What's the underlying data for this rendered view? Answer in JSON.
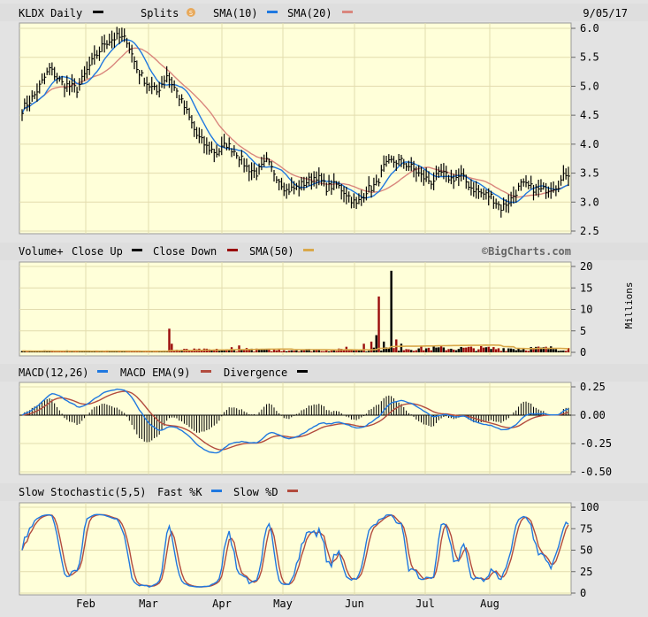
{
  "chart_data": {
    "type": "line",
    "ticker_label": "KLDX Daily",
    "date": "9/05/17",
    "watermark": "©BigCharts.com",
    "x_months": [
      "Feb",
      "Mar",
      "Apr",
      "May",
      "Jun",
      "Jul",
      "Aug"
    ],
    "colors": {
      "panel_bg": "#ffffd9",
      "grid": "#e2dcae",
      "header_bg": "#dedede",
      "sma10": "#1f78e0",
      "sma20": "#d9867d",
      "volume_up": "#000000",
      "volume_down": "#9a0b0b",
      "volume_sma": "#d9a84a",
      "macd": "#1f78e0",
      "macd_ema": "#b24b3e",
      "fast_k": "#1f78e0",
      "slow_d": "#b24b3e"
    },
    "price_panel": {
      "legend": {
        "name": "KLDX Daily",
        "splits": "Splits",
        "sma10": "SMA(10)",
        "sma20": "SMA(20)"
      },
      "ylim": [
        2.5,
        6.0
      ],
      "y_ticks": [
        "6.0",
        "5.5",
        "5.0",
        "4.5",
        "4.0",
        "3.5",
        "3.0",
        "2.5"
      ],
      "close_anchors": [
        [
          0,
          4.6
        ],
        [
          5,
          4.85
        ],
        [
          11,
          5.3
        ],
        [
          16,
          5.05
        ],
        [
          22,
          4.95
        ],
        [
          27,
          5.35
        ],
        [
          33,
          5.75
        ],
        [
          38,
          5.85
        ],
        [
          42,
          5.8
        ],
        [
          46,
          5.3
        ],
        [
          50,
          5.05
        ],
        [
          54,
          4.9
        ],
        [
          58,
          5.2
        ],
        [
          62,
          4.9
        ],
        [
          66,
          4.55
        ],
        [
          70,
          4.15
        ],
        [
          74,
          3.95
        ],
        [
          78,
          3.85
        ],
        [
          82,
          4.0
        ],
        [
          86,
          3.85
        ],
        [
          90,
          3.6
        ],
        [
          94,
          3.5
        ],
        [
          98,
          3.7
        ],
        [
          102,
          3.45
        ],
        [
          106,
          3.2
        ],
        [
          110,
          3.25
        ],
        [
          114,
          3.35
        ],
        [
          118,
          3.45
        ],
        [
          122,
          3.25
        ],
        [
          126,
          3.3
        ],
        [
          130,
          3.15
        ],
        [
          134,
          2.95
        ],
        [
          138,
          3.2
        ],
        [
          142,
          3.3
        ],
        [
          145,
          3.6
        ],
        [
          148,
          3.7
        ],
        [
          152,
          3.7
        ],
        [
          156,
          3.6
        ],
        [
          160,
          3.45
        ],
        [
          164,
          3.35
        ],
        [
          168,
          3.5
        ],
        [
          172,
          3.4
        ],
        [
          176,
          3.45
        ],
        [
          180,
          3.25
        ],
        [
          184,
          3.15
        ],
        [
          188,
          3.1
        ],
        [
          192,
          2.9
        ],
        [
          196,
          3.05
        ],
        [
          200,
          3.3
        ],
        [
          204,
          3.25
        ],
        [
          208,
          3.2
        ],
        [
          212,
          3.25
        ],
        [
          215,
          3.3
        ],
        [
          218,
          3.5
        ]
      ]
    },
    "volume_panel": {
      "legend": {
        "name": "Volume+",
        "close_up": "Close Up",
        "close_down": "Close Down",
        "sma50": "SMA(50)"
      },
      "ylim": [
        0,
        20
      ],
      "y_ticks": [
        "20",
        "15",
        "10",
        "5",
        "0"
      ],
      "unit": "Millions",
      "base_range": [
        0.3,
        1.5
      ],
      "spikes": [
        [
          59,
          5.5
        ],
        [
          60,
          2.0
        ],
        [
          84,
          1.2
        ],
        [
          87,
          1.6
        ],
        [
          90,
          1.0
        ],
        [
          130,
          1.3
        ],
        [
          137,
          2.0
        ],
        [
          140,
          2.5
        ],
        [
          142,
          4.0
        ],
        [
          143,
          13.0
        ],
        [
          145,
          2.5
        ],
        [
          148,
          19.0
        ],
        [
          150,
          3.0
        ],
        [
          152,
          2.0
        ]
      ]
    },
    "macd_panel": {
      "legend": {
        "macd": "MACD(12,26)",
        "ema": "MACD EMA(9)",
        "divergence": "Divergence"
      },
      "ylim": [
        -0.5,
        0.25
      ],
      "y_ticks": [
        "0.25",
        "0.00",
        "-0.25",
        "-0.50"
      ]
    },
    "stoch_panel": {
      "legend": {
        "name": "Slow Stochastic(5,5)",
        "fast_k": "Fast %K",
        "slow_d": "Slow %D"
      },
      "ylim": [
        0,
        100
      ],
      "y_ticks": [
        "100",
        "75",
        "50",
        "25",
        "0"
      ]
    }
  }
}
